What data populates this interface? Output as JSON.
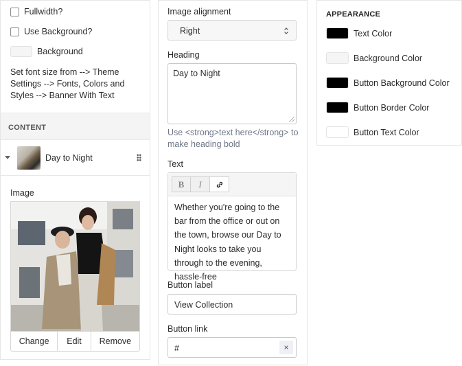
{
  "left": {
    "fullwidth_label": "Fullwidth?",
    "use_background_label": "Use Background?",
    "background_label": "Background",
    "note": "Set font size from --> Theme Settings --> Fonts, Colors and Styles --> Banner With Text",
    "content_heading": "CONTENT",
    "content_item": "Day to Night",
    "image_label": "Image",
    "buttons": {
      "change": "Change",
      "edit": "Edit",
      "remove": "Remove"
    }
  },
  "middle": {
    "image_alignment_label": "Image alignment",
    "image_alignment_value": "Right",
    "heading_label": "Heading",
    "heading_value": "Day to Night",
    "heading_hint": "Use <strong>text here</strong> to make heading bold",
    "text_label": "Text",
    "toolbar": {
      "bold": "B",
      "italic": "I",
      "link_icon": "link-icon"
    },
    "text_value": "Whether you're going to the bar from the office or out on the town, browse our Day to Night looks to take you through to the evening, hassle-free",
    "button_label_label": "Button label",
    "button_label_value": "View Collection",
    "button_link_label": "Button link",
    "button_link_value": "#",
    "clear_icon": "×"
  },
  "right": {
    "title": "APPEARANCE",
    "colors": [
      {
        "label": "Text Color",
        "color": "#000000"
      },
      {
        "label": "Background Color",
        "color": "#f5f5f5"
      },
      {
        "label": "Button Background Color",
        "color": "#000000"
      },
      {
        "label": "Button Border Color",
        "color": "#000000"
      },
      {
        "label": "Button Text Color",
        "color": "#ffffff"
      }
    ]
  }
}
